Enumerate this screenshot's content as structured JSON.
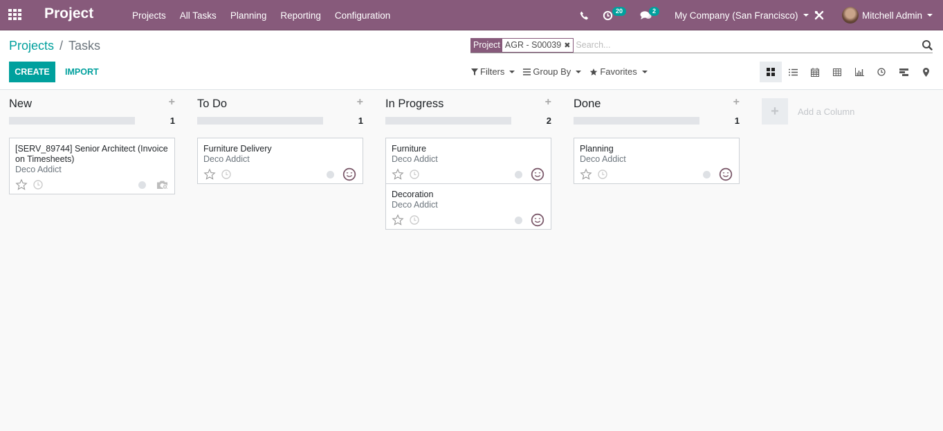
{
  "navbar": {
    "app_title": "Project",
    "menu": [
      "Projects",
      "All Tasks",
      "Planning",
      "Reporting",
      "Configuration"
    ],
    "activity_count": "20",
    "messages_count": "2",
    "company": "My Company (San Francisco)",
    "user": "Mitchell Admin"
  },
  "breadcrumb": {
    "parent": "Projects",
    "separator": "/",
    "current": "Tasks"
  },
  "buttons": {
    "create": "CREATE",
    "import": "IMPORT"
  },
  "search": {
    "facet_label": "Project",
    "facet_value": "AGR - S00039",
    "placeholder": "Search..."
  },
  "filters": {
    "filters_label": "Filters",
    "groupby_label": "Group By",
    "favorites_label": "Favorites"
  },
  "views": [
    "kanban",
    "list",
    "calendar",
    "pivot",
    "graph",
    "activity",
    "gantt",
    "map"
  ],
  "active_view": "kanban",
  "columns": [
    {
      "title": "New",
      "count": "1",
      "cards": [
        {
          "title": "[SERV_89744] Senior Architect (Invoice on Timesheets)",
          "customer": "Deco Addict",
          "avatar": "camera"
        }
      ]
    },
    {
      "title": "To Do",
      "count": "1",
      "cards": [
        {
          "title": "Furniture Delivery",
          "customer": "Deco Addict",
          "avatar": "smile"
        }
      ]
    },
    {
      "title": "In Progress",
      "count": "2",
      "cards": [
        {
          "title": "Furniture",
          "customer": "Deco Addict",
          "avatar": "smile"
        },
        {
          "title": "Decoration",
          "customer": "Deco Addict",
          "avatar": "smile"
        }
      ]
    },
    {
      "title": "Done",
      "count": "1",
      "cards": [
        {
          "title": "Planning",
          "customer": "Deco Addict",
          "avatar": "smile"
        }
      ]
    }
  ],
  "add_column_label": "Add a Column",
  "colors": {
    "brand": "#875a7b",
    "accent": "#00a09d"
  }
}
